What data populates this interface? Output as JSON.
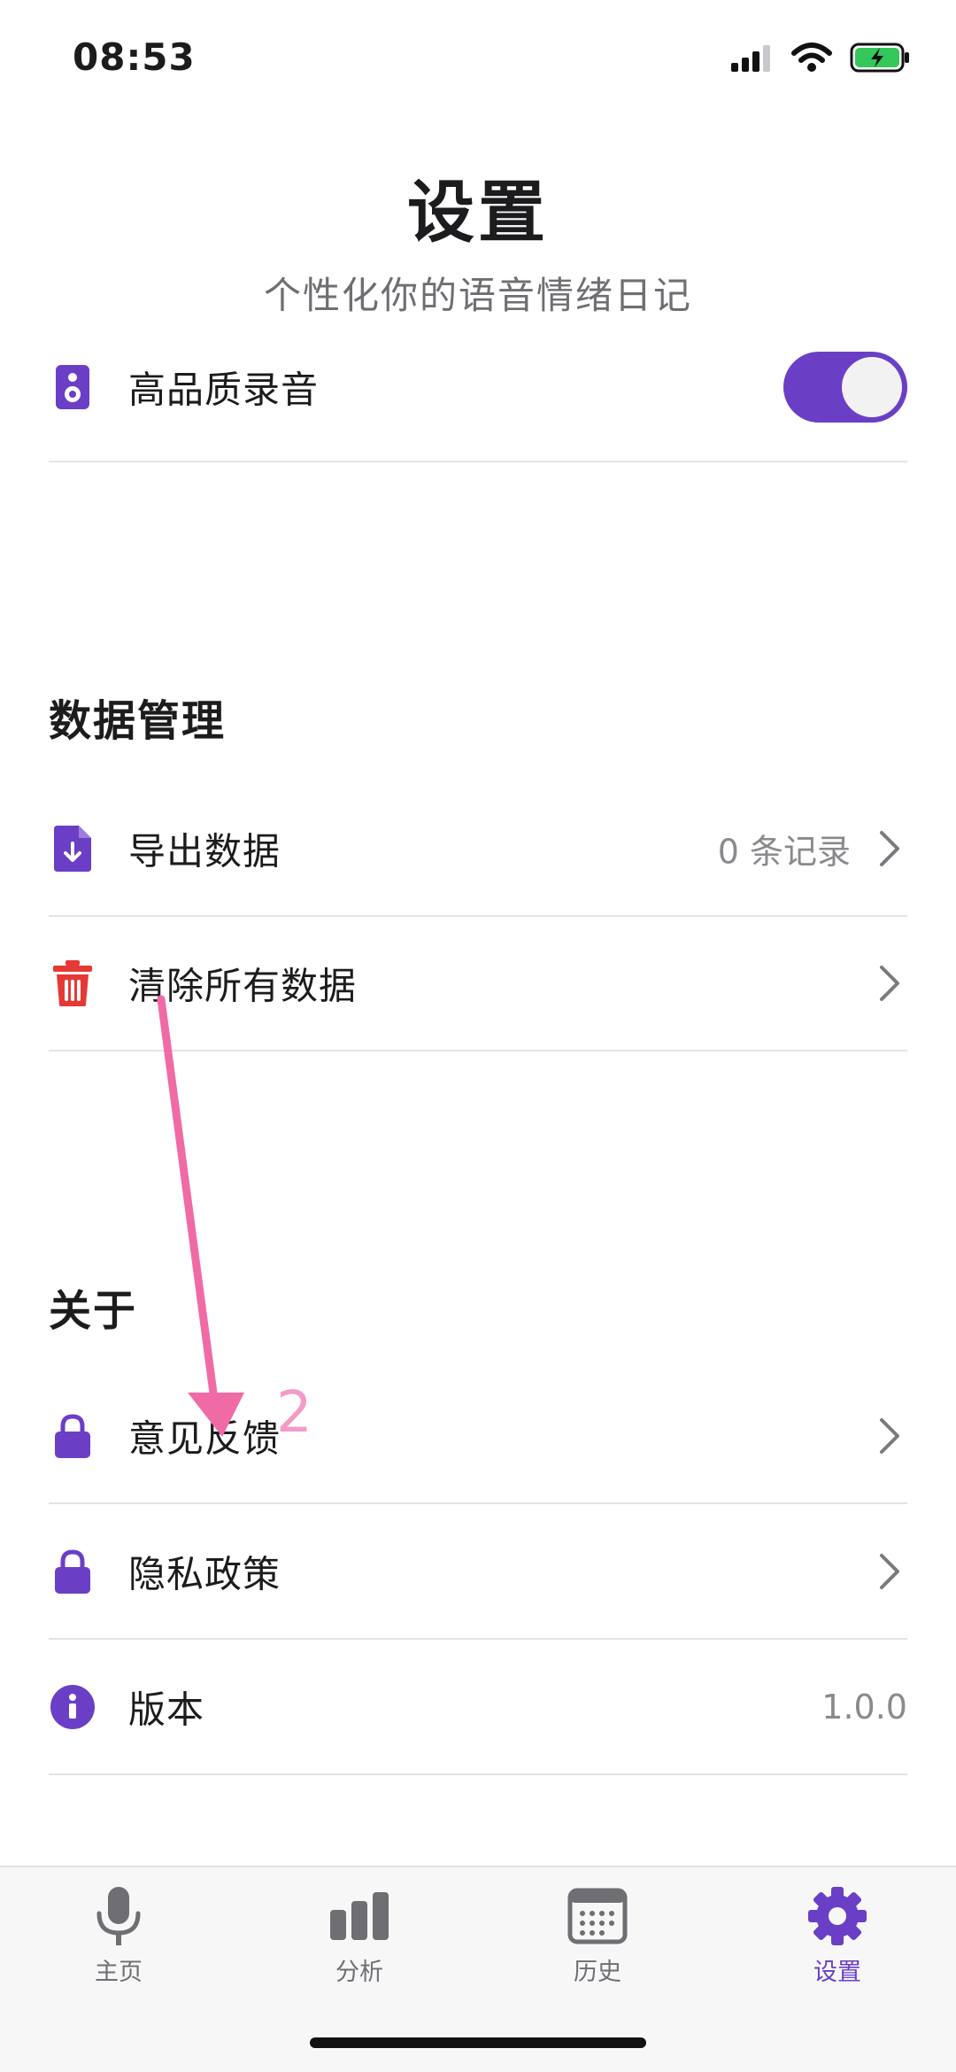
{
  "status_bar": {
    "time": "08:53"
  },
  "header": {
    "title": "设置",
    "subtitle": "个性化你的语音情绪日记"
  },
  "recording": {
    "label": "高品质录音",
    "toggle_on": true
  },
  "data_section": {
    "title": "数据管理",
    "items": [
      {
        "label": "导出数据",
        "value": "0 条记录",
        "icon": "file-download-icon"
      },
      {
        "label": "清除所有数据",
        "icon": "trash-icon"
      }
    ]
  },
  "about_section": {
    "title": "关于",
    "items": [
      {
        "label": "意见反馈",
        "icon": "lock-icon"
      },
      {
        "label": "隐私政策",
        "icon": "lock-icon"
      },
      {
        "label": "版本",
        "value": "1.0.0",
        "icon": "info-icon"
      }
    ]
  },
  "annotation": {
    "label": "2"
  },
  "tabs": [
    {
      "label": "主页",
      "icon": "microphone-icon"
    },
    {
      "label": "分析",
      "icon": "bar-chart-icon"
    },
    {
      "label": "历史",
      "icon": "calendar-icon"
    },
    {
      "label": "设置",
      "icon": "gear-icon",
      "active": true
    }
  ],
  "colors": {
    "accent": "#6a3fc5",
    "danger": "#e53935",
    "annotation": "#f06ba6"
  }
}
